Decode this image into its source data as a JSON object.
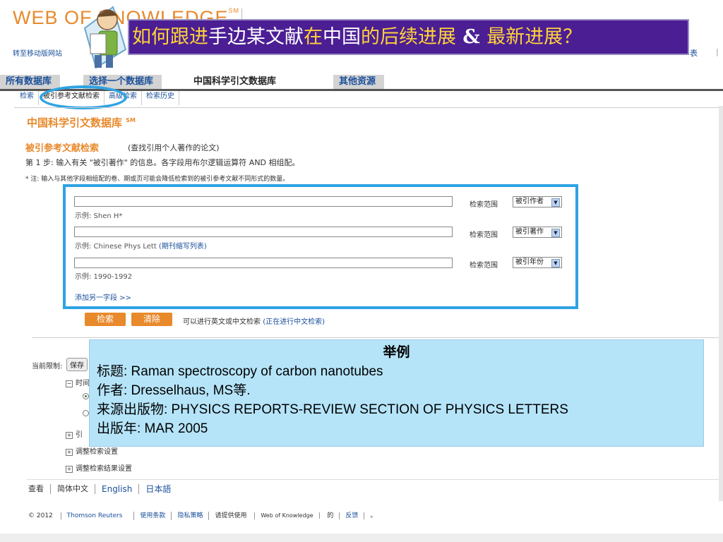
{
  "header": {
    "logo_text": "WEB OF KNOWLEDGE",
    "logo_sup": "SM",
    "mobile_link": "转至移动版网站",
    "right_item_1": "表",
    "right_item_2": "|"
  },
  "banner": {
    "part1": "如何跟进",
    "part2": "手边某文献",
    "part3": "在",
    "part4": "中国",
    "part5": "的后续进展",
    "part6": " & ",
    "part7": "最新进展？"
  },
  "tabs": [
    {
      "label": "所有数据库"
    },
    {
      "label": "选择一个数据库"
    },
    {
      "label": "中国科学引文数据库"
    },
    {
      "label": "其他资源"
    }
  ],
  "subnav": [
    {
      "label": "检索"
    },
    {
      "label": "被引参考文献检索"
    },
    {
      "label": "高级检索"
    },
    {
      "label": "检索历史"
    }
  ],
  "page": {
    "db_title": "中国科学引文数据库",
    "db_sup": "SM",
    "search_title": "被引参考文献检索",
    "search_sub": "(查找引用个人著作的论文)",
    "step": "第 1 步: 输入有关 \"被引著作\" 的信息。各字段用布尔逻辑运算符 AND 相组配。",
    "note": "* 注: 输入与其他字段相组配的卷、期或页可能会降低检索到的被引参考文献不同形式的数量。"
  },
  "form": {
    "rows": [
      {
        "value": "",
        "example": "示例: Shen H*",
        "example_link": "",
        "scope_label": "检索范围",
        "scope_value": "被引作者"
      },
      {
        "value": "",
        "example": "示例: Chinese Phys Lett ",
        "example_link": "(期刊缩写列表)",
        "scope_label": "检索范围",
        "scope_value": "被引著作"
      },
      {
        "value": "",
        "example": "示例: 1990-1992",
        "example_link": "",
        "scope_label": "检索范围",
        "scope_value": "被引年份"
      }
    ],
    "add_field": "添加另一字段 >>",
    "search_btn": "检索",
    "clear_btn": "清除",
    "hint": "可以进行英文或中文检索 ",
    "hint_link": "(正在进行中文检索)"
  },
  "limits": {
    "label": "当前限制:",
    "save_btn": "保存",
    "time_label": "时间",
    "tree": [
      "引",
      "调整检索设置",
      "调整检索结果设置"
    ]
  },
  "languages": {
    "label": "查看",
    "items": [
      "简体中文",
      "English",
      "日本語"
    ]
  },
  "footer": {
    "copyright": "© 2012 ",
    "company": "Thomson Reuters",
    "terms": "使用条款",
    "privacy": "隐私策略",
    "feedback_prefix": "请提供使用 ",
    "feedback_product": "Web of Knowledge",
    "feedback_mid": " 的",
    "feedback_link": "反馈",
    "feedback_end": "。"
  },
  "example_box": {
    "heading": "举例",
    "title": "标题: Raman spectroscopy of carbon nanotubes",
    "author": "作者: Dresselhaus, MS等.",
    "source": "来源出版物: PHYSICS REPORTS-REVIEW SECTION OF PHYSICS LETTERS",
    "year": "出版年: MAR 2005"
  },
  "colors": {
    "accent_orange": "#e8892b",
    "link_blue": "#1a4f9a",
    "highlight_blue": "#2ea3e3",
    "banner_purple": "#4b1e94"
  }
}
